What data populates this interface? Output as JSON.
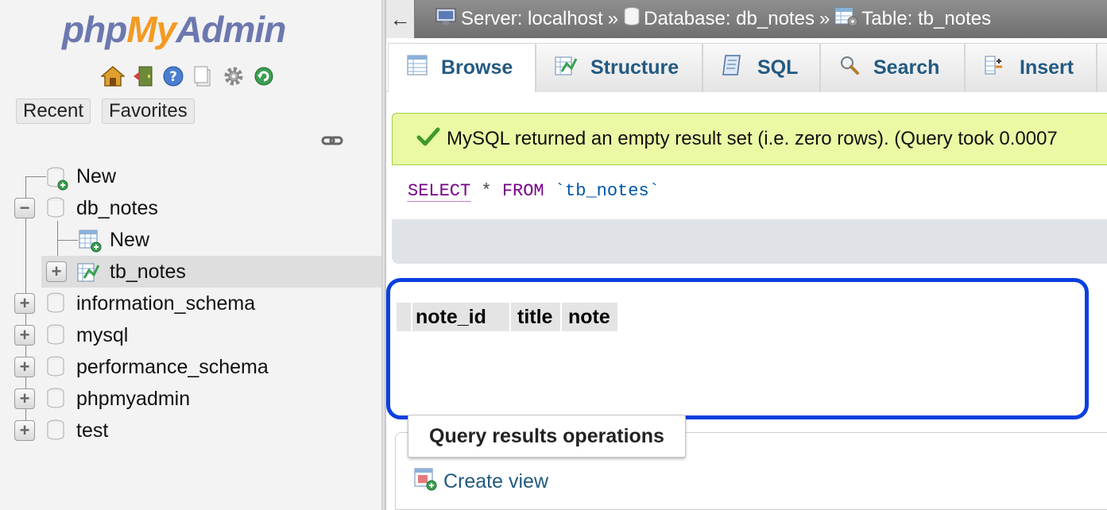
{
  "app": {
    "logo": {
      "php": "php",
      "my": "My",
      "admin": "Admin"
    },
    "nav_icons": [
      "home-icon",
      "exit-icon",
      "help-icon",
      "docs-icon",
      "settings-icon",
      "reload-icon"
    ]
  },
  "sidebar": {
    "recent_label": "Recent",
    "favorites_label": "Favorites",
    "tree": [
      {
        "label": "New",
        "type": "new-db"
      },
      {
        "label": "db_notes",
        "type": "database",
        "expanded": true
      },
      {
        "label": "New",
        "type": "new-table"
      },
      {
        "label": "tb_notes",
        "type": "table",
        "selected": true
      },
      {
        "label": "information_schema",
        "type": "database"
      },
      {
        "label": "mysql",
        "type": "database"
      },
      {
        "label": "performance_schema",
        "type": "database"
      },
      {
        "label": "phpmyadmin",
        "type": "database"
      },
      {
        "label": "test",
        "type": "database"
      }
    ]
  },
  "breadcrumb": {
    "back": "←",
    "server": "Server: localhost",
    "database": "Database: db_notes",
    "table": "Table: tb_notes",
    "separator": "»"
  },
  "tabs": [
    {
      "label": "Browse",
      "icon": "browse-icon",
      "active": true
    },
    {
      "label": "Structure",
      "icon": "structure-icon"
    },
    {
      "label": "SQL",
      "icon": "sql-icon"
    },
    {
      "label": "Search",
      "icon": "search-icon"
    },
    {
      "label": "Insert",
      "icon": "insert-icon"
    }
  ],
  "message": {
    "text": "MySQL returned an empty result set (i.e. zero rows). (Query took 0.0007",
    "color": "#ebf8a4"
  },
  "query": {
    "select": "SELECT",
    "star": "*",
    "from": "FROM",
    "table": "`tb_notes`"
  },
  "result_columns": [
    "note_id",
    "title",
    "note"
  ],
  "highlight_color": "#0a3fe0",
  "operations": {
    "legend": "Query results operations",
    "create_view": "Create view"
  }
}
